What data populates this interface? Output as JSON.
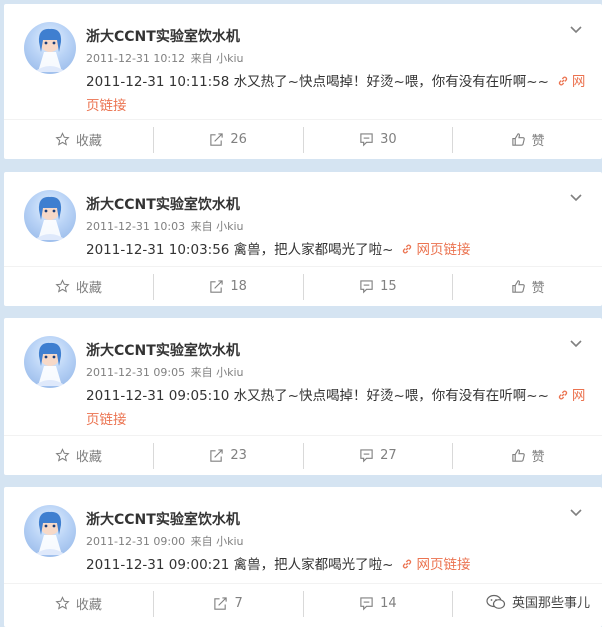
{
  "posts": [
    {
      "author": "浙大CCNT实验室饮水机",
      "time": "2011-12-31 10:12",
      "source_prefix": "来自",
      "source": "小kiu",
      "text": "2011-12-31 10:11:58 水又热了~快点喝掉！好烫~喂，你有没有在听啊~~",
      "link_label": "网页链接",
      "actions": {
        "fav": "收藏",
        "repost": "26",
        "comment": "30",
        "like": "赞"
      }
    },
    {
      "author": "浙大CCNT实验室饮水机",
      "time": "2011-12-31 10:03",
      "source_prefix": "来自",
      "source": "小kiu",
      "text": "2011-12-31 10:03:56 禽兽，把人家都喝光了啦~",
      "link_label": "网页链接",
      "actions": {
        "fav": "收藏",
        "repost": "18",
        "comment": "15",
        "like": "赞"
      }
    },
    {
      "author": "浙大CCNT实验室饮水机",
      "time": "2011-12-31 09:05",
      "source_prefix": "来自",
      "source": "小kiu",
      "text": "2011-12-31 09:05:10 水又热了~快点喝掉！好烫~喂，你有没有在听啊~~",
      "link_label": "网页链接",
      "actions": {
        "fav": "收藏",
        "repost": "23",
        "comment": "27",
        "like": "赞"
      }
    },
    {
      "author": "浙大CCNT实验室饮水机",
      "time": "2011-12-31 09:00",
      "source_prefix": "来自",
      "source": "小kiu",
      "text": "2011-12-31 09:00:21 禽兽，把人家都喝光了啦~",
      "link_label": "网页链接",
      "actions": {
        "fav": "收藏",
        "repost": "7",
        "comment": "14",
        "like": ""
      }
    }
  ],
  "watermark": "英国那些事儿",
  "colors": {
    "link": "#eb7350",
    "background": "#d5e4f2",
    "muted": "#808080"
  },
  "icons": [
    "chevron-down-icon",
    "link-icon",
    "star-icon",
    "repost-icon",
    "comment-icon",
    "like-icon",
    "wechat-icon"
  ]
}
